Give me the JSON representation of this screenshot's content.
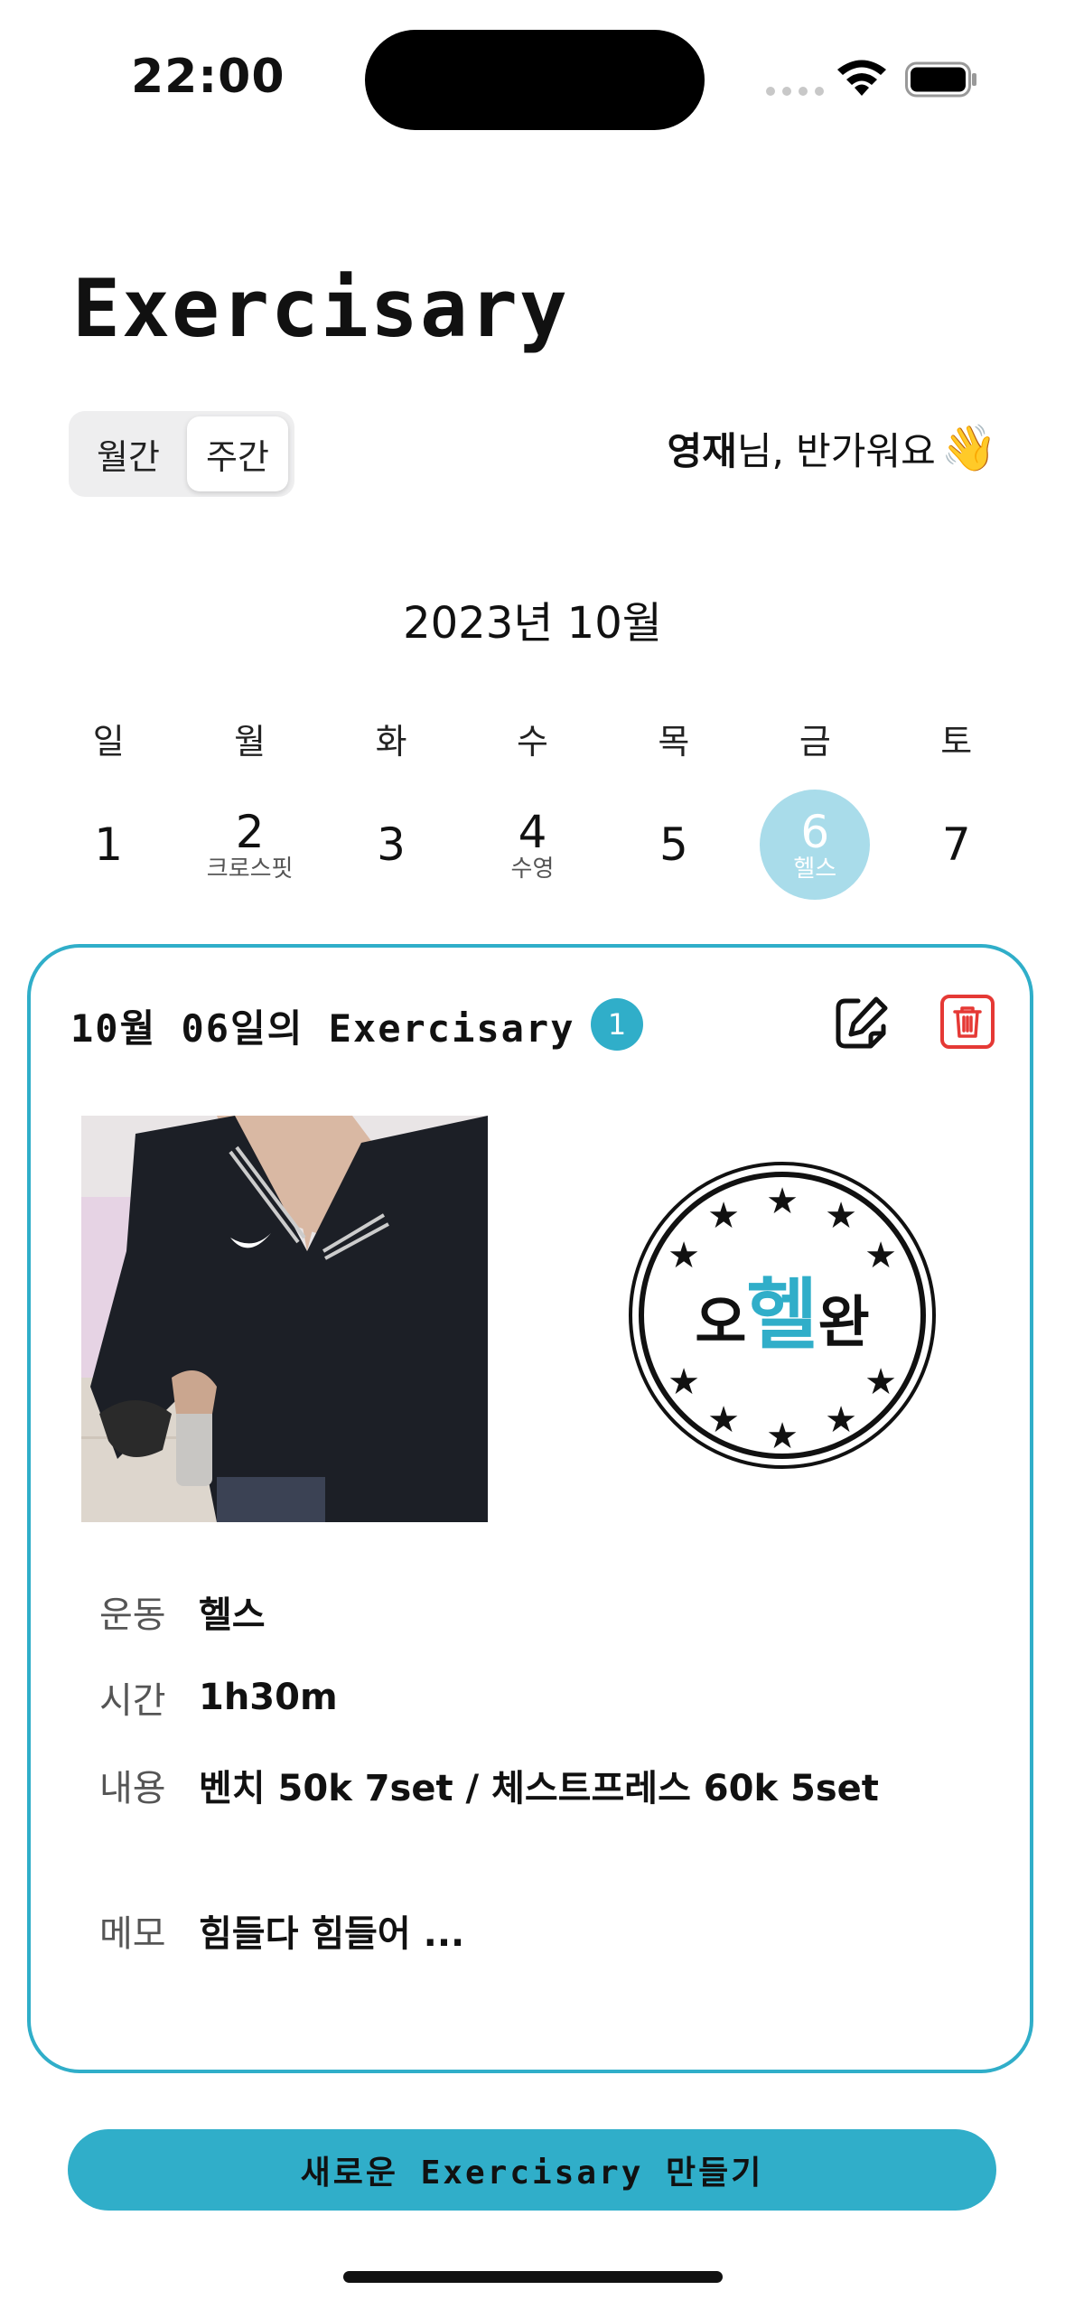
{
  "status": {
    "time": "22:00"
  },
  "app": {
    "title": "Exercisary"
  },
  "view_toggle": {
    "month_label": "월간",
    "week_label": "주간",
    "selected": "주간"
  },
  "greeting": {
    "name": "영재",
    "text": "님, 반가워요",
    "emoji": "👋"
  },
  "calendar": {
    "month_label": "2023년 10월",
    "weekdays": [
      "일",
      "월",
      "화",
      "수",
      "목",
      "금",
      "토"
    ],
    "days": [
      {
        "num": "1",
        "tag": ""
      },
      {
        "num": "2",
        "tag": "크로스핏"
      },
      {
        "num": "3",
        "tag": ""
      },
      {
        "num": "4",
        "tag": "수영"
      },
      {
        "num": "5",
        "tag": ""
      },
      {
        "num": "6",
        "tag": "헬스"
      },
      {
        "num": "7",
        "tag": ""
      }
    ],
    "selected_day": "6"
  },
  "entry": {
    "title": "10월 06일의 Exercisary",
    "count": "1",
    "stamp_text": {
      "pre": "오",
      "mid": "헬",
      "post": "완"
    },
    "fields": {
      "exercise_label": "운동",
      "exercise_value": "헬스",
      "time_label": "시간",
      "time_value": "1h30m",
      "content_label": "내용",
      "content_value": "벤치 50k 7set / 체스트프레스 60k 5set",
      "memo_label": "메모",
      "memo_value": "힘들다 힘들어 ..."
    }
  },
  "cta": {
    "label": "새로운 Exercisary 만들기"
  },
  "colors": {
    "accent": "#30aec9",
    "selected_day": "#a9dcea",
    "delete": "#e53935"
  }
}
